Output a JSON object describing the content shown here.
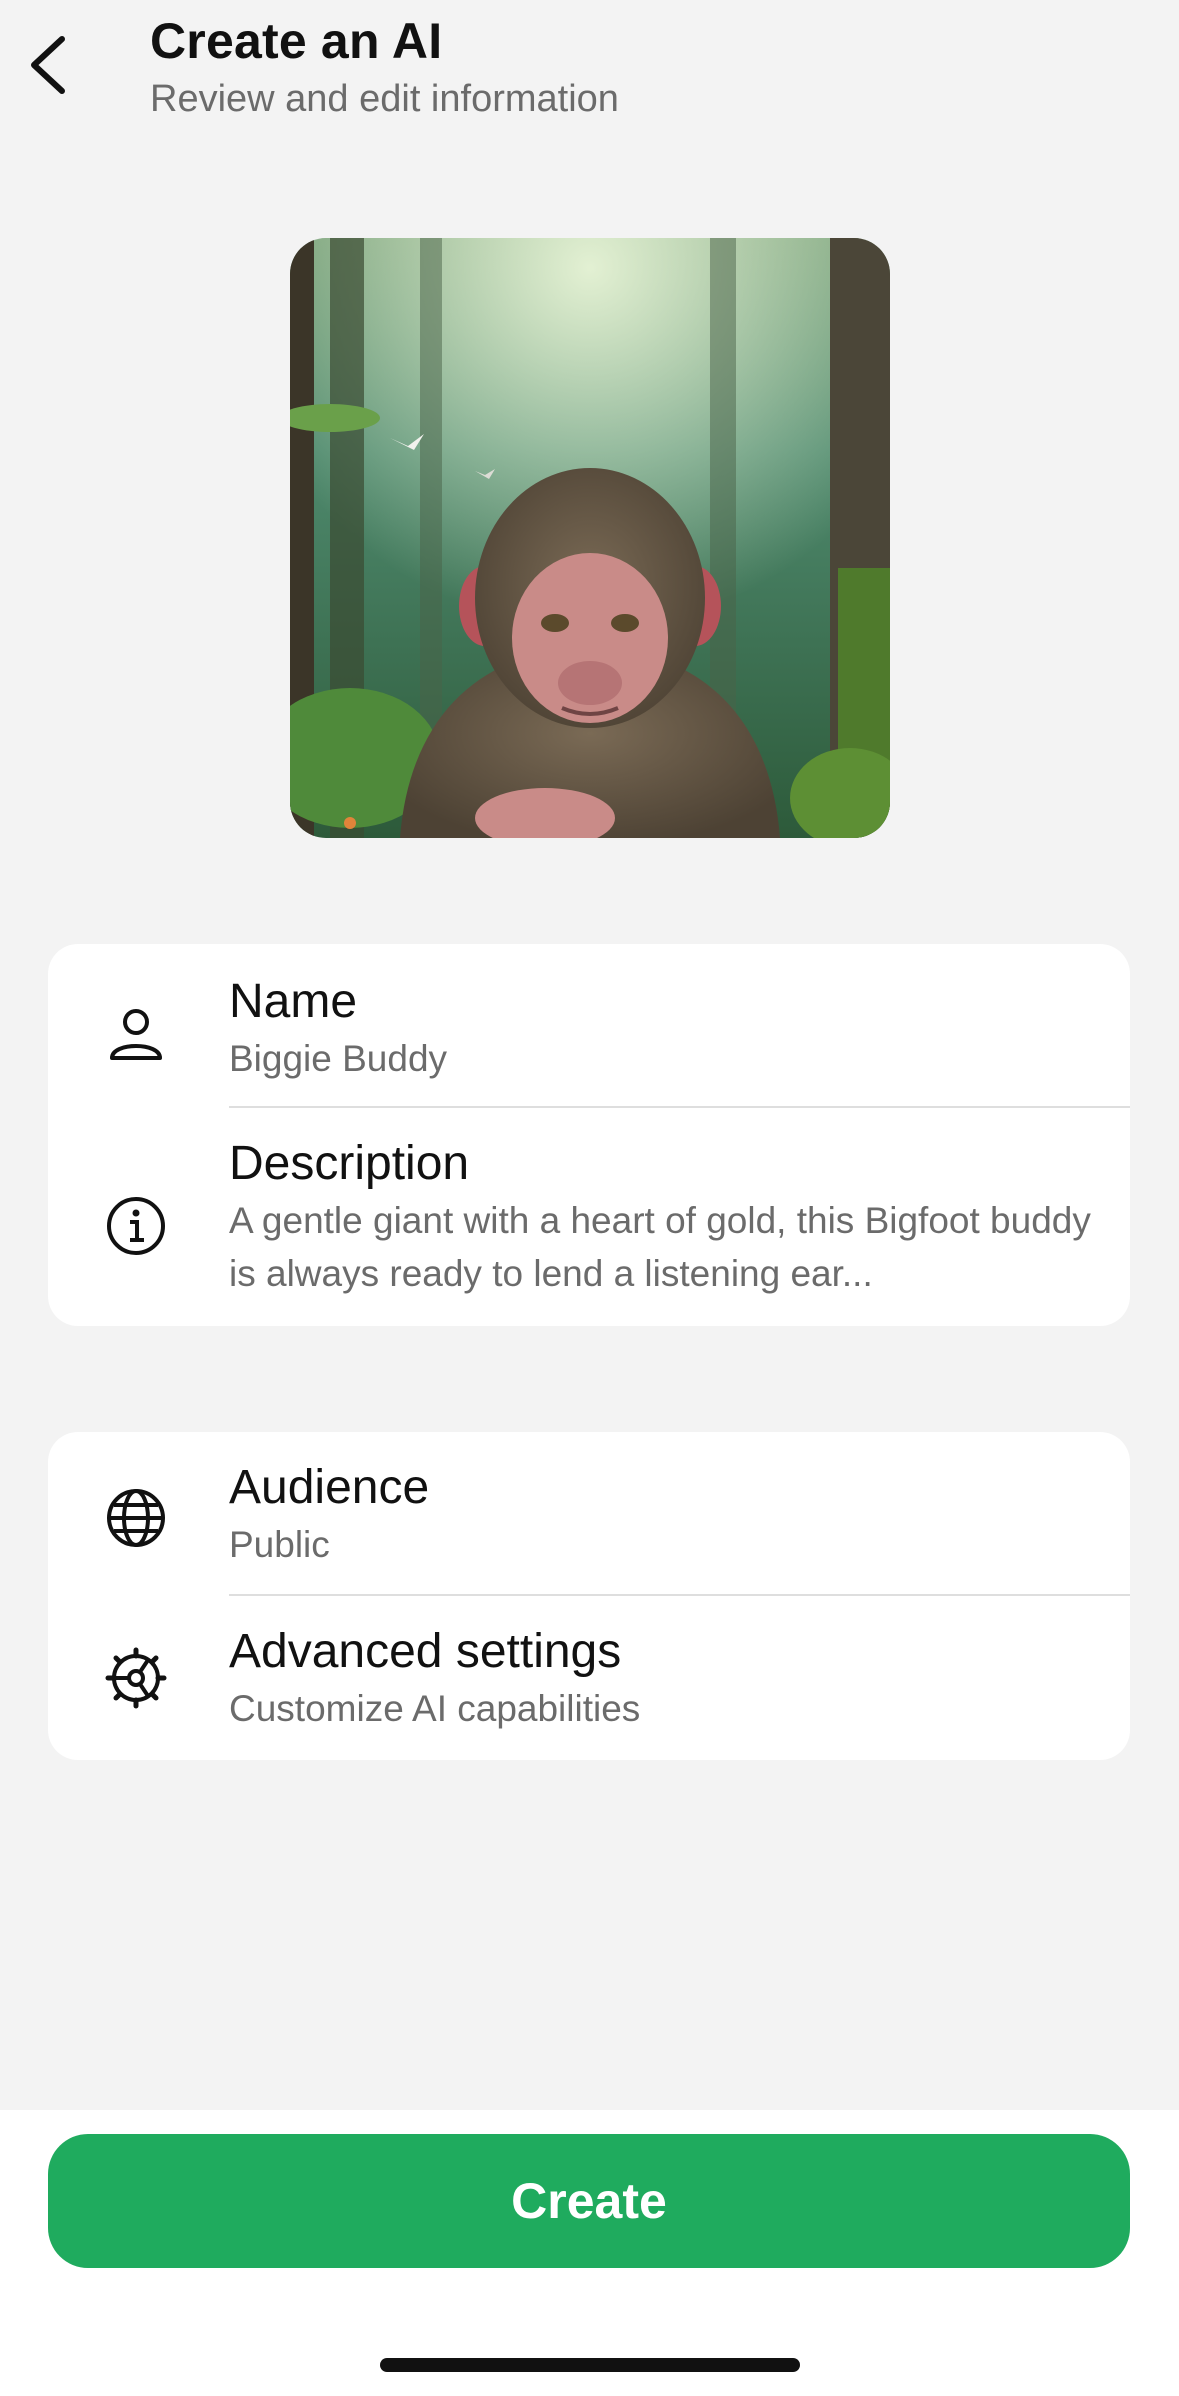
{
  "header": {
    "title": "Create an AI",
    "subtitle": "Review and edit information",
    "back_icon": "chevron-left-icon"
  },
  "avatar": {
    "description_icon": "ai-avatar-image"
  },
  "info_card": {
    "rows": [
      {
        "icon": "person-icon",
        "label": "Name",
        "value": "Biggie Buddy"
      },
      {
        "icon": "info-icon",
        "label": "Description",
        "value": "A gentle giant with a heart of gold, this Bigfoot buddy is always ready to lend a listening ear..."
      }
    ]
  },
  "settings_card": {
    "rows": [
      {
        "icon": "globe-icon",
        "label": "Audience",
        "value": "Public"
      },
      {
        "icon": "gear-icon",
        "label": "Advanced settings",
        "value": "Customize AI capabilities"
      }
    ]
  },
  "footer": {
    "create_label": "Create"
  },
  "colors": {
    "accent": "#1fab5e",
    "background": "#f3f3f3",
    "card": "#ffffff",
    "secondary_text": "#6b6b6b"
  }
}
